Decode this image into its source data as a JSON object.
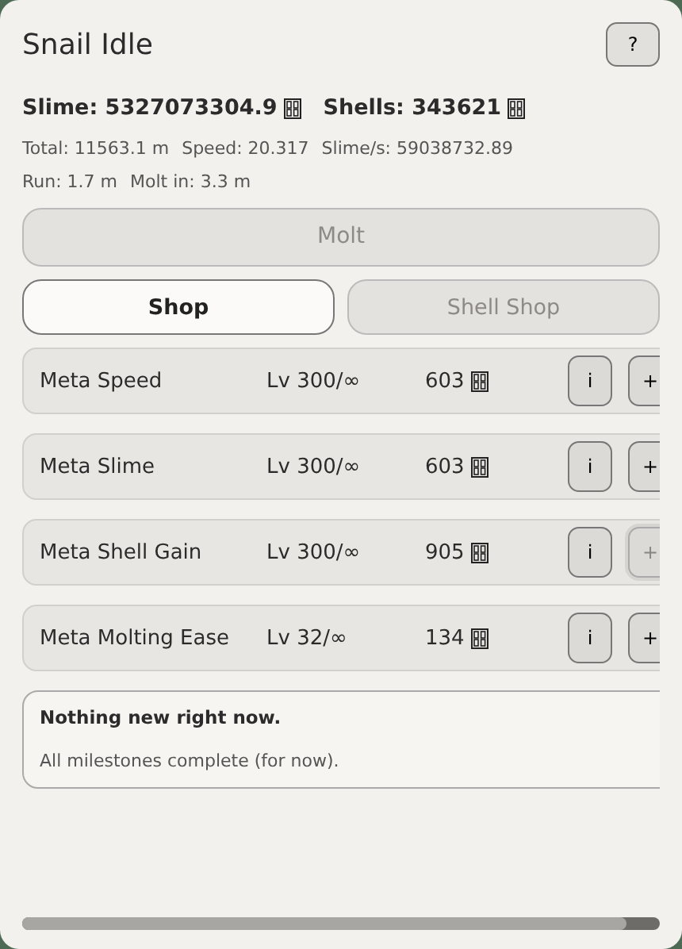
{
  "title": "Snail Idle",
  "help_button": "?",
  "currencies": [
    {
      "label": "Slime: 5327073304.9"
    },
    {
      "label": "Shells: 343621"
    }
  ],
  "stats": [
    [
      "Total: 11563.1 m",
      "Speed: 20.317",
      "Slime/s: 59038732.89"
    ],
    [
      "Run: 1.7 m",
      "Molt in: 3.3 m"
    ]
  ],
  "molt_button": {
    "label": "Molt",
    "disabled": true
  },
  "tabs": [
    {
      "label": "Shop",
      "selected": true
    },
    {
      "label": "Shell Shop",
      "selected": false
    }
  ],
  "items": [
    {
      "name": "Meta Speed",
      "level": "Lv 300/∞",
      "cost": "603",
      "info": "i",
      "buy": "+",
      "buy_disabled": false
    },
    {
      "name": "Meta Slime",
      "level": "Lv 300/∞",
      "cost": "603",
      "info": "i",
      "buy": "+",
      "buy_disabled": false
    },
    {
      "name": "Meta Shell Gain",
      "level": "Lv 300/∞",
      "cost": "905",
      "info": "i",
      "buy": "+",
      "buy_disabled": true
    },
    {
      "name": "Meta Molting Ease",
      "level": "Lv 32/∞",
      "cost": "134",
      "info": "i",
      "buy": "+",
      "buy_disabled": false
    }
  ],
  "notice": {
    "heading": "Nothing new right now.",
    "text": "All milestones complete (for now)."
  }
}
